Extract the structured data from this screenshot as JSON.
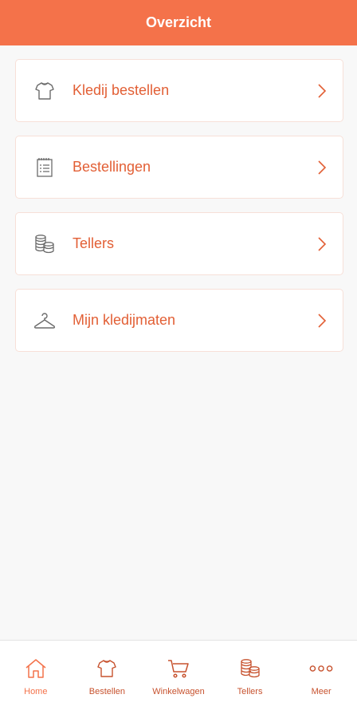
{
  "header": {
    "title": "Overzicht"
  },
  "colors": {
    "accent": "#f4724a",
    "label": "#e25f35",
    "tab": "#c7522e",
    "icon": "#6b6b6b"
  },
  "menu": {
    "items": [
      {
        "label": "Kledij bestellen",
        "icon": "shirt-icon"
      },
      {
        "label": "Bestellingen",
        "icon": "order-list-icon"
      },
      {
        "label": "Tellers",
        "icon": "coins-icon"
      },
      {
        "label": "Mijn kledijmaten",
        "icon": "hanger-icon"
      }
    ]
  },
  "tabbar": {
    "tabs": [
      {
        "label": "Home",
        "icon": "home-icon",
        "active": true
      },
      {
        "label": "Bestellen",
        "icon": "shirt-icon"
      },
      {
        "label": "Winkelwagen",
        "icon": "cart-icon"
      },
      {
        "label": "Tellers",
        "icon": "coins-icon"
      },
      {
        "label": "Meer",
        "icon": "more-icon"
      }
    ]
  }
}
